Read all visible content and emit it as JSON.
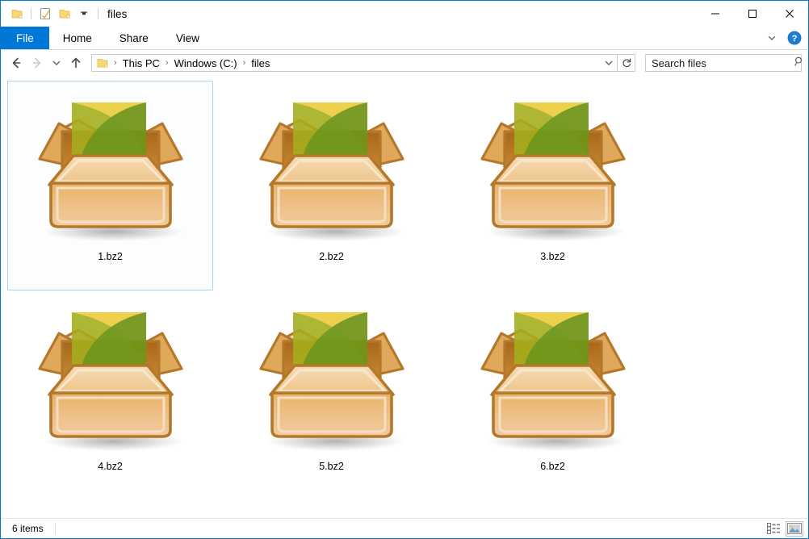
{
  "window": {
    "title": "files",
    "accent_color": "#0078d7",
    "selection_border_color": "#a6d8f5"
  },
  "quick_access_toolbar": {
    "items": [
      {
        "name": "folder-icon",
        "label": "Folder"
      },
      {
        "name": "properties-icon",
        "label": "Properties"
      },
      {
        "name": "new-folder-icon",
        "label": "New folder"
      },
      {
        "name": "chevron-down-icon",
        "label": "Customize Quick Access Toolbar"
      }
    ]
  },
  "window_controls": {
    "minimize": "Minimize",
    "maximize": "Maximize",
    "close": "Close"
  },
  "ribbon": {
    "tabs": [
      {
        "label": "File",
        "active": true
      },
      {
        "label": "Home",
        "active": false
      },
      {
        "label": "Share",
        "active": false
      },
      {
        "label": "View",
        "active": false
      }
    ],
    "collapse_label": "Expand the Ribbon",
    "help_label": "Help"
  },
  "navigation": {
    "back": "Back",
    "forward": "Forward",
    "recent": "Recent locations",
    "up": "Up"
  },
  "breadcrumb": {
    "items": [
      "This PC",
      "Windows (C:)",
      "files"
    ],
    "separator": "›",
    "dropdown_label": "Previous locations"
  },
  "refresh": {
    "label": "Refresh"
  },
  "search": {
    "placeholder": "Search files",
    "value": "",
    "icon_label": "Search"
  },
  "files": [
    {
      "name": "1.bz2",
      "icon": "archive-box-icon",
      "selected": true
    },
    {
      "name": "2.bz2",
      "icon": "archive-box-icon",
      "selected": false
    },
    {
      "name": "3.bz2",
      "icon": "archive-box-icon",
      "selected": false
    },
    {
      "name": "4.bz2",
      "icon": "archive-box-icon",
      "selected": false
    },
    {
      "name": "5.bz2",
      "icon": "archive-box-icon",
      "selected": false
    },
    {
      "name": "6.bz2",
      "icon": "archive-box-icon",
      "selected": false
    }
  ],
  "status": {
    "item_count": "6 items"
  },
  "view_toggles": [
    {
      "name": "details-view-icon",
      "label": "Details view",
      "active": false
    },
    {
      "name": "large-icons-view-icon",
      "label": "Large icons view",
      "active": true
    }
  ]
}
